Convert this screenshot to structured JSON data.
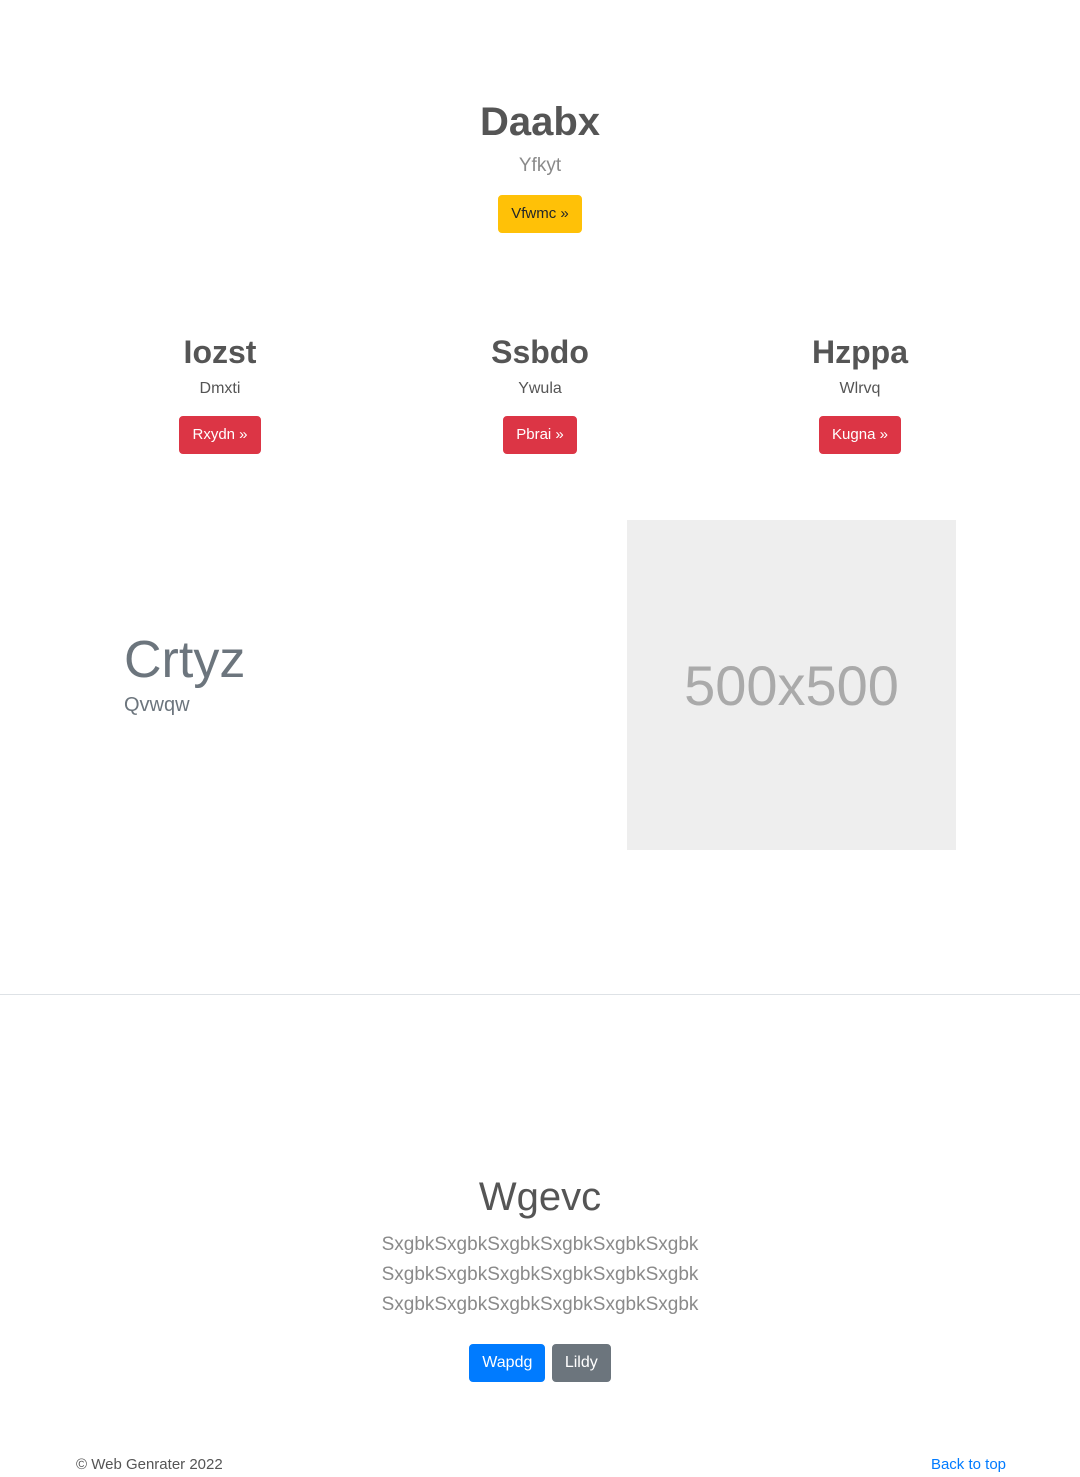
{
  "hero": {
    "title": "Daabx",
    "subtitle": "Yfkyt",
    "button_label": "Vfwmc »"
  },
  "features": [
    {
      "title": "Iozst",
      "subtitle": "Dmxti",
      "button_label": "Rxydn »"
    },
    {
      "title": "Ssbdo",
      "subtitle": "Ywula",
      "button_label": "Pbrai »"
    },
    {
      "title": "Hzppa",
      "subtitle": "Wlrvq",
      "button_label": "Kugna »"
    }
  ],
  "split": {
    "title": "Crtyz",
    "subtitle": "Qvwqw",
    "image_placeholder": "500x500"
  },
  "cta": {
    "title": "Wgevc",
    "body": "SxgbkSxgbkSxgbkSxgbkSxgbkSxgbk SxgbkSxgbkSxgbkSxgbkSxgbkSxgbk SxgbkSxgbkSxgbkSxgbkSxgbkSxgbk",
    "primary_label": "Wapdg",
    "secondary_label": "Lildy"
  },
  "footer": {
    "copyright": "© Web Genrater 2022",
    "back_to_top": "Back to top"
  },
  "colors": {
    "warning": "#ffc107",
    "danger": "#dc3545",
    "primary": "#007bff",
    "secondary": "#6c757d"
  }
}
